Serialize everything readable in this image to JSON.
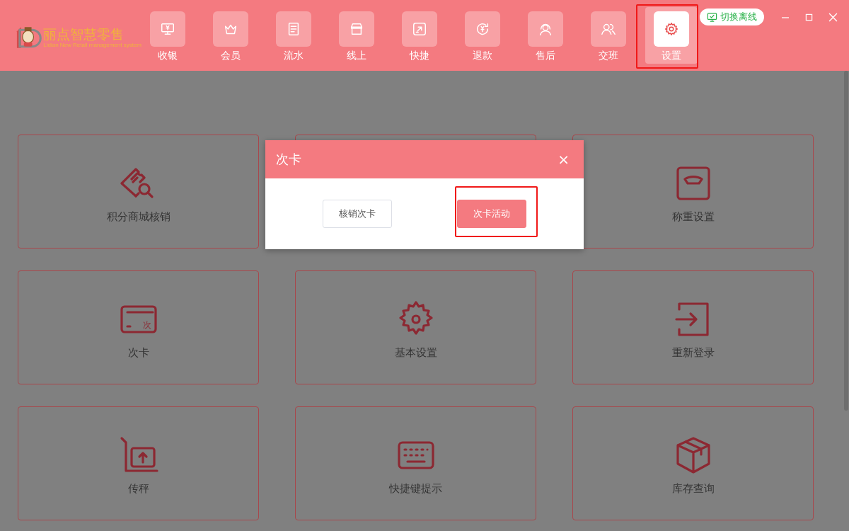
{
  "logo": {
    "title": "丽点智慧零售",
    "subtitle": "Lidian New Retail management system"
  },
  "nav": [
    {
      "label": "收银",
      "kind": "monitor",
      "selected": false
    },
    {
      "label": "会员",
      "kind": "crown",
      "selected": false
    },
    {
      "label": "流水",
      "kind": "list",
      "selected": false
    },
    {
      "label": "线上",
      "kind": "store",
      "selected": false
    },
    {
      "label": "快捷",
      "kind": "shortcut",
      "selected": false
    },
    {
      "label": "退款",
      "kind": "refund",
      "selected": false
    },
    {
      "label": "售后",
      "kind": "headset",
      "selected": false
    },
    {
      "label": "交班",
      "kind": "users",
      "selected": false
    },
    {
      "label": "设置",
      "kind": "gear",
      "selected": true
    }
  ],
  "offline_button": "切换离线",
  "cards": [
    {
      "label": "积分商城核销",
      "kind": "ticket"
    },
    {
      "kind": "covered"
    },
    {
      "label": "称重设置",
      "kind": "scale"
    },
    {
      "label": "次卡",
      "kind": "card",
      "icon_text": "次"
    },
    {
      "label": "基本设置",
      "kind": "gear"
    },
    {
      "label": "重新登录",
      "kind": "login"
    },
    {
      "label": "传秤",
      "kind": "upload"
    },
    {
      "label": "快捷键提示",
      "kind": "keyboard"
    },
    {
      "label": "库存查询",
      "kind": "box"
    }
  ],
  "dialog": {
    "title": "次卡",
    "close": "×",
    "buttons": [
      {
        "label": "核销次卡",
        "kind": "default"
      },
      {
        "label": "次卡活动",
        "kind": "primary"
      }
    ]
  }
}
